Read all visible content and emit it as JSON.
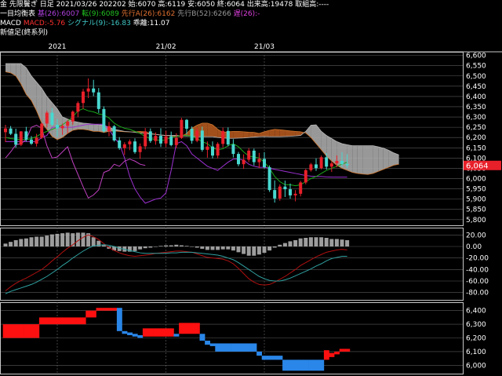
{
  "header": {
    "line1": "金 先限鬢ぎ 日足 2021/03/26 202202 始:6070 高:6119 安:6050 終:6064 出来高:19478 取組高:----",
    "ichimoku_label": "一目均衡表",
    "ichimoku_kijun": "基(26):6007",
    "ichimoku_tenkan": "転(9):6089",
    "ichimoku_senkou_a": "先行A(26):6162",
    "ichimoku_senkou_b": "先行B(52):6266",
    "ichimoku_chikou": "遅(26):-",
    "macd_label": "MACD",
    "macd_value": "MACD:-5.76",
    "macd_signal": "シグナル(9):-16.83",
    "macd_hist": "乖離:11.07",
    "line4": "新値足(終系列)"
  },
  "colors": {
    "up": "#e8202a",
    "down": "#48d8d0",
    "kijun": "#9b30d0",
    "tenkan": "#1aa61a",
    "cloud_bear": "#a9a9a9",
    "cloud_bull": "#b3581e",
    "macd_line": "#b01010",
    "signal_line": "#30a0a0",
    "hist": "#b8b8b8",
    "renko_up": "#ff1010",
    "renko_down": "#2a86e8",
    "price_box": "#e8202a"
  },
  "x_labels": [
    {
      "text": "2021",
      "index": 10
    },
    {
      "text": "21/02",
      "index": 31
    },
    {
      "text": "21/03",
      "index": 50
    }
  ],
  "price_axis": {
    "ticks": [
      "6,600",
      "6,550",
      "6,500",
      "6,450",
      "6,400",
      "6,350",
      "6,300",
      "6,250",
      "6,200",
      "6,150",
      "6,100",
      "6,050",
      "6,000",
      "5,950",
      "5,900",
      "5,850",
      "5,800"
    ],
    "min": 5780,
    "max": 6610,
    "current": 6064,
    "current_label": "6,064"
  },
  "macd_axis": {
    "ticks": [
      "20.00",
      "0.00",
      "-20.00",
      "-40.00",
      "-60.00",
      "-80.00"
    ],
    "min": -90,
    "max": 30
  },
  "renko_axis": {
    "ticks": [
      "6,400",
      "6,300",
      "6,200",
      "6,100",
      "6,000"
    ],
    "min": 5950,
    "max": 6450
  },
  "chart_data": {
    "type": "candlestick",
    "ohlc": [
      [
        6226,
        6262,
        6178,
        6244
      ],
      [
        6244,
        6256,
        6212,
        6218
      ],
      [
        6218,
        6243,
        6151,
        6165
      ],
      [
        6165,
        6231,
        6158,
        6230
      ],
      [
        6230,
        6252,
        6180,
        6190
      ],
      [
        6190,
        6207,
        6164,
        6170
      ],
      [
        6170,
        6218,
        6156,
        6199
      ],
      [
        6199,
        6271,
        6193,
        6268
      ],
      [
        6268,
        6330,
        6249,
        6321
      ],
      [
        6321,
        6344,
        6254,
        6262
      ],
      [
        6262,
        6290,
        6203,
        6245
      ],
      [
        6245,
        6268,
        6213,
        6257
      ],
      [
        6257,
        6286,
        6221,
        6278
      ],
      [
        6278,
        6332,
        6263,
        6326
      ],
      [
        6326,
        6376,
        6299,
        6368
      ],
      [
        6368,
        6437,
        6340,
        6424
      ],
      [
        6424,
        6488,
        6392,
        6439
      ],
      [
        6439,
        6481,
        6402,
        6420
      ],
      [
        6420,
        6441,
        6320,
        6339
      ],
      [
        6339,
        6352,
        6224,
        6231
      ],
      [
        6231,
        6276,
        6206,
        6255
      ],
      [
        6255,
        6261,
        6180,
        6186
      ],
      [
        6186,
        6202,
        6140,
        6148
      ],
      [
        6148,
        6177,
        6115,
        6167
      ],
      [
        6167,
        6191,
        6138,
        6181
      ],
      [
        6181,
        6196,
        6121,
        6129
      ],
      [
        6129,
        6171,
        6096,
        6157
      ],
      [
        6157,
        6246,
        6142,
        6230
      ],
      [
        6230,
        6244,
        6174,
        6183
      ],
      [
        6183,
        6225,
        6165,
        6208
      ],
      [
        6208,
        6245,
        6154,
        6171
      ],
      [
        6171,
        6233,
        6154,
        6206
      ],
      [
        6206,
        6229,
        6157,
        6163
      ],
      [
        6163,
        6221,
        6148,
        6198
      ],
      [
        6198,
        6296,
        6193,
        6286
      ],
      [
        6286,
        6290,
        6215,
        6243
      ],
      [
        6243,
        6254,
        6170,
        6184
      ],
      [
        6184,
        6248,
        6177,
        6234
      ],
      [
        6234,
        6253,
        6131,
        6140
      ],
      [
        6140,
        6181,
        6102,
        6156
      ],
      [
        6156,
        6181,
        6098,
        6112
      ],
      [
        6112,
        6177,
        6098,
        6169
      ],
      [
        6169,
        6248,
        6152,
        6232
      ],
      [
        6232,
        6249,
        6157,
        6166
      ],
      [
        6166,
        6192,
        6103,
        6120
      ],
      [
        6120,
        6130,
        6060,
        6070
      ],
      [
        6070,
        6118,
        6047,
        6092
      ],
      [
        6092,
        6148,
        6080,
        6136
      ],
      [
        6136,
        6146,
        6064,
        6080
      ],
      [
        6080,
        6125,
        6052,
        6096
      ],
      [
        6096,
        6129,
        6050,
        6055
      ],
      [
        6055,
        6064,
        5935,
        5944
      ],
      [
        5944,
        5991,
        5883,
        5903
      ],
      [
        5903,
        5972,
        5892,
        5961
      ],
      [
        5961,
        5990,
        5910,
        5948
      ],
      [
        5948,
        5976,
        5902,
        5918
      ],
      [
        5918,
        5944,
        5889,
        5926
      ],
      [
        5926,
        5989,
        5913,
        5981
      ],
      [
        5981,
        6047,
        5972,
        6041
      ],
      [
        6041,
        6076,
        6034,
        6069
      ],
      [
        6069,
        6098,
        6037,
        6051
      ],
      [
        6051,
        6112,
        6045,
        6104
      ],
      [
        6104,
        6124,
        6044,
        6058
      ],
      [
        6058,
        6082,
        6032,
        6074
      ],
      [
        6074,
        6113,
        6055,
        6086
      ],
      [
        6086,
        6128,
        6057,
        6071
      ],
      [
        6071,
        6119,
        6050,
        6064
      ]
    ],
    "tenkan": [
      6200,
      6195,
      6192,
      6190,
      6190,
      6195,
      6205,
      6220,
      6230,
      6240,
      6250,
      6262,
      6280,
      6300,
      6330,
      6340,
      6330,
      6325,
      6315,
      6310,
      6295,
      6270,
      6255,
      6245,
      6240,
      6230,
      6220,
      6205,
      6195,
      6190,
      6185,
      6190,
      6200,
      6205,
      6210,
      6210,
      6205,
      6195,
      6180,
      6170,
      6150,
      6140,
      6145,
      6160,
      6170,
      6155,
      6130,
      6110,
      6105,
      6100,
      6080,
      6050,
      6010,
      5985,
      5970,
      5970,
      5965,
      5970,
      5985,
      6000,
      6010,
      6025,
      6040,
      6050,
      6060,
      6070,
      6080
    ],
    "kijun": [
      6180,
      6180,
      6180,
      6180,
      6180,
      6180,
      6180,
      6200,
      6210,
      6250,
      6250,
      6250,
      6250,
      6250,
      6255,
      6260,
      6265,
      6265,
      6265,
      6265,
      6240,
      6200,
      6170,
      6100,
      6010,
      5950,
      5910,
      5880,
      5890,
      5900,
      5905,
      5930,
      6040,
      6170,
      6180,
      6160,
      6120,
      6100,
      6080,
      6060,
      6050,
      6040,
      6060,
      6080,
      6095,
      6095,
      6090,
      6070,
      6060,
      6055,
      6055,
      6050,
      6045,
      6040,
      6035,
      6030,
      6025,
      6020,
      6015,
      6012,
      6010,
      6010,
      6008,
      6007,
      6007,
      6007,
      6007
    ],
    "senkou_a": [
      6520,
      6515,
      6500,
      6460,
      6410,
      6380,
      6330,
      6270,
      6240,
      6205,
      6190,
      6200,
      6220,
      6235,
      6240,
      6240,
      6236,
      6230,
      6230,
      6225,
      6230,
      6232,
      6230,
      6228,
      6227,
      6228,
      6230,
      6228,
      6220,
      6216,
      6212,
      6210,
      6208,
      6205,
      6206,
      6220,
      6245,
      6260,
      6270,
      6270,
      6262,
      6240,
      6225,
      6228,
      6230,
      6230,
      6228,
      6226,
      6225,
      6220,
      6228,
      6235,
      6240,
      6238,
      6235,
      6232,
      6230,
      6228,
      6222,
      6200,
      6170,
      6140,
      6110,
      6085,
      6065,
      6050,
      6040,
      6030,
      6025,
      6022,
      6020,
      6025,
      6035,
      6045,
      6055,
      6065,
      6070
    ],
    "senkou_b": [
      6560,
      6560,
      6560,
      6560,
      6540,
      6500,
      6470,
      6440,
      6400,
      6370,
      6340,
      6300,
      6290,
      6280,
      6275,
      6270,
      6268,
      6265,
      6262,
      6260,
      6250,
      6240,
      6235,
      6230,
      6228,
      6225,
      6222,
      6220,
      6217,
      6215,
      6212,
      6210,
      6210,
      6210,
      6208,
      6207,
      6205,
      6204,
      6204,
      6204,
      6204,
      6200,
      6198,
      6196,
      6196,
      6197,
      6198,
      6200,
      6202,
      6204,
      6205,
      6204,
      6204,
      6204,
      6205,
      6206,
      6208,
      6210,
      6230,
      6260,
      6262,
      6230,
      6210,
      6195,
      6180,
      6170,
      6165,
      6160,
      6160,
      6160,
      6160,
      6160,
      6155,
      6148,
      6138,
      6125,
      6115
    ],
    "chikou": [
      6100,
      6130,
      6165,
      6170,
      6190,
      6250,
      6260,
      6245,
      6160,
      6100,
      6105,
      6130,
      6155,
      6080,
      6020,
      5960,
      5905,
      5920,
      5945,
      6030,
      6040,
      6070,
      6060,
      6085,
      6095,
      6085,
      6070,
      6064
    ],
    "macd": [
      -77,
      -70,
      -64,
      -59,
      -55,
      -50,
      -45,
      -40,
      -33,
      -25,
      -18,
      -10,
      -3,
      3,
      10,
      16,
      20,
      17,
      12,
      5,
      -2,
      -7,
      -11,
      -14,
      -16,
      -17,
      -16,
      -15,
      -14,
      -12,
      -11,
      -10,
      -9,
      -8,
      -8,
      -9,
      -10,
      -13,
      -16,
      -19,
      -20,
      -21,
      -22,
      -25,
      -30,
      -38,
      -47,
      -56,
      -62,
      -66,
      -67,
      -66,
      -62,
      -57,
      -52,
      -46,
      -40,
      -33,
      -28,
      -23,
      -18,
      -14,
      -10,
      -8,
      -6,
      -5,
      -6
    ],
    "signal": [
      -82,
      -78,
      -75,
      -72,
      -69,
      -66,
      -62,
      -57,
      -52,
      -46,
      -40,
      -33,
      -27,
      -20,
      -14,
      -8,
      -3,
      1,
      2,
      3,
      2,
      0,
      -3,
      -5,
      -7,
      -9,
      -11,
      -12,
      -12,
      -12,
      -12,
      -12,
      -11,
      -11,
      -10,
      -10,
      -10,
      -11,
      -12,
      -13,
      -14,
      -15,
      -17,
      -20,
      -23,
      -28,
      -34,
      -40,
      -46,
      -52,
      -56,
      -59,
      -60,
      -60,
      -58,
      -55,
      -51,
      -47,
      -43,
      -39,
      -34,
      -30,
      -25,
      -21,
      -19,
      -17,
      -17
    ],
    "renko": [
      {
        "low": 6200,
        "high": 6300,
        "dir": "up"
      },
      {
        "low": 6200,
        "high": 6300,
        "dir": "up"
      },
      {
        "low": 6200,
        "high": 6300,
        "dir": "up"
      },
      {
        "low": 6200,
        "high": 6300,
        "dir": "up"
      },
      {
        "low": 6200,
        "high": 6300,
        "dir": "up"
      },
      {
        "low": 6200,
        "high": 6300,
        "dir": "up"
      },
      {
        "low": 6200,
        "high": 6300,
        "dir": "up"
      },
      {
        "low": 6300,
        "high": 6350,
        "dir": "up"
      },
      {
        "low": 6300,
        "high": 6350,
        "dir": "up"
      },
      {
        "low": 6300,
        "high": 6350,
        "dir": "up"
      },
      {
        "low": 6300,
        "high": 6350,
        "dir": "up"
      },
      {
        "low": 6300,
        "high": 6350,
        "dir": "up"
      },
      {
        "low": 6300,
        "high": 6350,
        "dir": "up"
      },
      {
        "low": 6300,
        "high": 6350,
        "dir": "up"
      },
      {
        "low": 6300,
        "high": 6350,
        "dir": "up"
      },
      {
        "low": 6300,
        "high": 6350,
        "dir": "up"
      },
      {
        "low": 6350,
        "high": 6400,
        "dir": "up"
      },
      {
        "low": 6350,
        "high": 6400,
        "dir": "up"
      },
      {
        "low": 6400,
        "high": 6420,
        "dir": "up"
      },
      {
        "low": 6400,
        "high": 6420,
        "dir": "up"
      },
      {
        "low": 6400,
        "high": 6420,
        "dir": "up"
      },
      {
        "low": 6400,
        "high": 6420,
        "dir": "up"
      },
      {
        "low": 6250,
        "high": 6420,
        "dir": "down"
      },
      {
        "low": 6230,
        "high": 6250,
        "dir": "down"
      },
      {
        "low": 6220,
        "high": 6240,
        "dir": "down"
      },
      {
        "low": 6210,
        "high": 6230,
        "dir": "down"
      },
      {
        "low": 6200,
        "high": 6220,
        "dir": "down"
      },
      {
        "low": 6210,
        "high": 6270,
        "dir": "up"
      },
      {
        "low": 6210,
        "high": 6270,
        "dir": "up"
      },
      {
        "low": 6210,
        "high": 6270,
        "dir": "up"
      },
      {
        "low": 6210,
        "high": 6270,
        "dir": "up"
      },
      {
        "low": 6210,
        "high": 6270,
        "dir": "up"
      },
      {
        "low": 6210,
        "high": 6270,
        "dir": "up"
      },
      {
        "low": 6210,
        "high": 6230,
        "dir": "down"
      },
      {
        "low": 6230,
        "high": 6310,
        "dir": "up"
      },
      {
        "low": 6230,
        "high": 6310,
        "dir": "up"
      },
      {
        "low": 6230,
        "high": 6310,
        "dir": "up"
      },
      {
        "low": 6230,
        "high": 6310,
        "dir": "up"
      },
      {
        "low": 6180,
        "high": 6230,
        "dir": "down"
      },
      {
        "low": 6150,
        "high": 6180,
        "dir": "down"
      },
      {
        "low": 6140,
        "high": 6160,
        "dir": "down"
      },
      {
        "low": 6100,
        "high": 6160,
        "dir": "down"
      },
      {
        "low": 6100,
        "high": 6160,
        "dir": "down"
      },
      {
        "low": 6100,
        "high": 6160,
        "dir": "down"
      },
      {
        "low": 6100,
        "high": 6160,
        "dir": "down"
      },
      {
        "low": 6100,
        "high": 6160,
        "dir": "down"
      },
      {
        "low": 6100,
        "high": 6160,
        "dir": "down"
      },
      {
        "low": 6100,
        "high": 6160,
        "dir": "down"
      },
      {
        "low": 6100,
        "high": 6160,
        "dir": "down"
      },
      {
        "low": 6070,
        "high": 6100,
        "dir": "down"
      },
      {
        "low": 6040,
        "high": 6070,
        "dir": "down"
      },
      {
        "low": 6040,
        "high": 6070,
        "dir": "down"
      },
      {
        "low": 6040,
        "high": 6070,
        "dir": "down"
      },
      {
        "low": 6040,
        "high": 6070,
        "dir": "down"
      },
      {
        "low": 5960,
        "high": 6040,
        "dir": "down"
      },
      {
        "low": 5960,
        "high": 6040,
        "dir": "down"
      },
      {
        "low": 5960,
        "high": 6040,
        "dir": "down"
      },
      {
        "low": 5960,
        "high": 6040,
        "dir": "down"
      },
      {
        "low": 5960,
        "high": 6040,
        "dir": "down"
      },
      {
        "low": 5960,
        "high": 6040,
        "dir": "down"
      },
      {
        "low": 5960,
        "high": 6040,
        "dir": "down"
      },
      {
        "low": 5960,
        "high": 6040,
        "dir": "down"
      },
      {
        "low": 6040,
        "high": 6110,
        "dir": "up"
      },
      {
        "low": 6060,
        "high": 6090,
        "dir": "up"
      },
      {
        "low": 6080,
        "high": 6100,
        "dir": "up"
      },
      {
        "low": 6100,
        "high": 6120,
        "dir": "up"
      },
      {
        "low": 6100,
        "high": 6120,
        "dir": "up"
      }
    ]
  }
}
